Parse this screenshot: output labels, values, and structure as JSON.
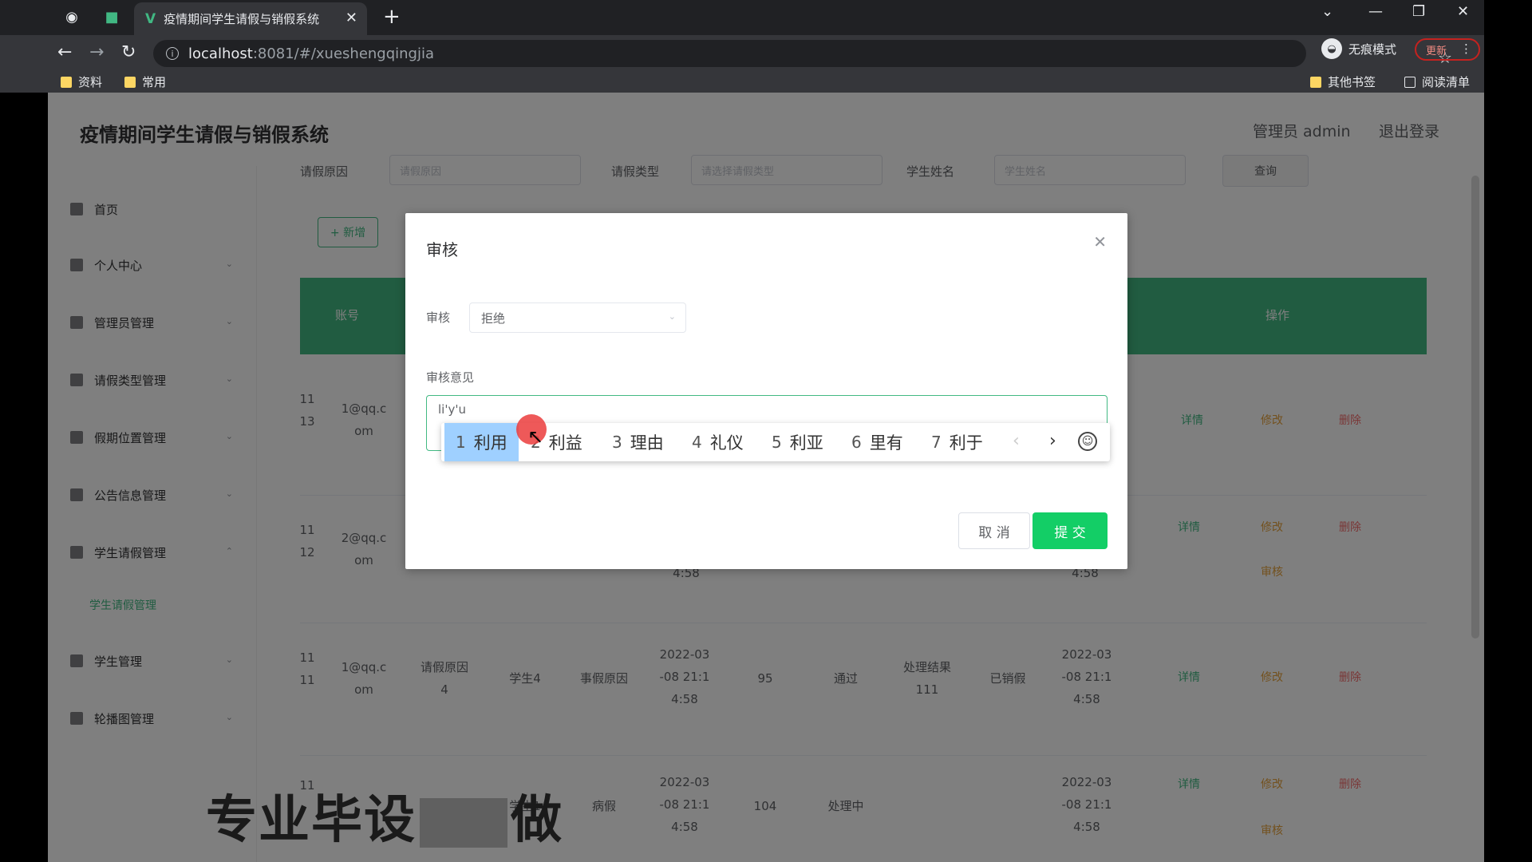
{
  "browser": {
    "tab_title": "疫情期间学生请假与销假系统",
    "tab_logo": "V",
    "url_host": "localhost",
    "url_path": ":8081/#/xueshengqingjia",
    "incognito_label": "无痕模式",
    "update_label": "更新",
    "bookmarks": [
      "资料",
      "常用"
    ],
    "other_bookmarks": "其他书签",
    "reading_list": "阅读清单"
  },
  "app": {
    "title": "疫情期间学生请假与销假系统",
    "admin_label": "管理员 admin",
    "logout_label": "退出登录"
  },
  "sidebar": {
    "items": [
      {
        "label": "首页"
      },
      {
        "label": "个人中心"
      },
      {
        "label": "管理员管理"
      },
      {
        "label": "请假类型管理"
      },
      {
        "label": "假期位置管理"
      },
      {
        "label": "公告信息管理"
      },
      {
        "label": "学生请假管理"
      },
      {
        "label": "学生请假管理"
      },
      {
        "label": "学生管理"
      },
      {
        "label": "轮播图管理"
      }
    ]
  },
  "filters": {
    "reason_label": "请假原因",
    "reason_placeholder": "请假原因",
    "type_label": "请假类型",
    "type_placeholder": "请选择请假类型",
    "name_label": "学生姓名",
    "name_placeholder": "学生姓名",
    "query_label": "查询",
    "add_label": "+ 新增"
  },
  "table": {
    "head_left": "账号",
    "head_right": "操作",
    "rows": [
      {
        "id": "11\n13",
        "email": "1@qq.c\nom"
      },
      {
        "id": "11\n12",
        "email": "2@qq.c\nom",
        "date": "4:58"
      },
      {
        "id": "11\n11",
        "email": "1@qq.c\nom",
        "reason": "请假原因\n4",
        "name": "学生4",
        "type": "事假原因",
        "date": "2022-03\n-08 21:1\n4:58",
        "days": "95",
        "status": "通过",
        "reply": "处理结果\n111",
        "state": "已销假",
        "date2": "2022-03\n-08 21:1\n4:58"
      },
      {
        "id": "11",
        "email": "",
        "reason": "",
        "name": "学生1",
        "type": "病假",
        "date": "2022-03\n-08 21:1\n4:58",
        "days": "104",
        "status": "处理中",
        "reply": "",
        "state": "",
        "date2": "2022-03\n-08 21:1\n4:58"
      }
    ],
    "ops": {
      "detail": "详情",
      "edit": "修改",
      "delete": "删除",
      "audit": "审核"
    }
  },
  "dialog": {
    "title": "审核",
    "audit_label": "审核",
    "audit_value": "拒绝",
    "opinion_label": "审核意见",
    "opinion_value": "li'y'u",
    "cancel_label": "取 消",
    "submit_label": "提 交"
  },
  "ime": {
    "candidates": [
      {
        "num": "1",
        "text": "利用"
      },
      {
        "num": "2",
        "text": "利益"
      },
      {
        "num": "3",
        "text": "理由"
      },
      {
        "num": "4",
        "text": "礼仪"
      },
      {
        "num": "5",
        "text": "利亚"
      },
      {
        "num": "6",
        "text": "里有"
      },
      {
        "num": "7",
        "text": "利于"
      }
    ]
  },
  "watermark": {
    "left": "专业毕设",
    "right": "做"
  }
}
